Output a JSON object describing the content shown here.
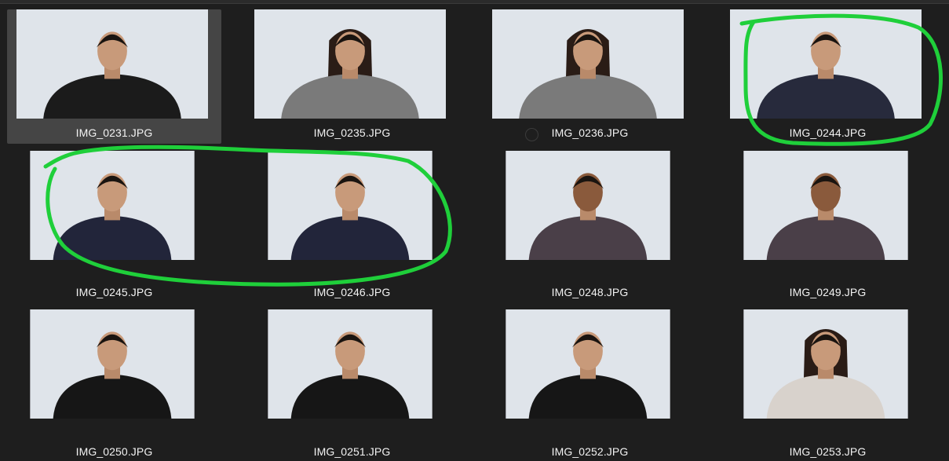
{
  "files": [
    {
      "name": "IMG_0231.JPG",
      "selected": true,
      "person": "man-short-black-tee",
      "shirt": "#1b1b1b"
    },
    {
      "name": "IMG_0235.JPG",
      "selected": false,
      "person": "woman-long-hair-gray",
      "shirt": "#7a7a7a"
    },
    {
      "name": "IMG_0236.JPG",
      "selected": false,
      "person": "woman-long-hair-gray",
      "shirt": "#7a7a7a"
    },
    {
      "name": "IMG_0244.JPG",
      "selected": false,
      "person": "man-wavy-navy",
      "shirt": "#272a3c"
    },
    {
      "name": "IMG_0245.JPG",
      "selected": false,
      "person": "man-wavy-navy",
      "shirt": "#22253a"
    },
    {
      "name": "IMG_0246.JPG",
      "selected": false,
      "person": "man-wavy-navy",
      "shirt": "#22253a"
    },
    {
      "name": "IMG_0248.JPG",
      "selected": false,
      "person": "man-patterned-shirt",
      "shirt": "#4a3f48"
    },
    {
      "name": "IMG_0249.JPG",
      "selected": false,
      "person": "man-patterned-shirt",
      "shirt": "#4a3f48"
    },
    {
      "name": "IMG_0250.JPG",
      "selected": false,
      "person": "man-black-shirt",
      "shirt": "#161616"
    },
    {
      "name": "IMG_0251.JPG",
      "selected": false,
      "person": "man-black-shirt",
      "shirt": "#161616"
    },
    {
      "name": "IMG_0252.JPG",
      "selected": false,
      "person": "man-black-shirt",
      "shirt": "#161616"
    },
    {
      "name": "IMG_0253.JPG",
      "selected": false,
      "person": "woman-floral-blouse",
      "shirt": "#d8d2cc"
    }
  ],
  "colors": {
    "background": "#1e1e1e",
    "selected_tile": "#454545",
    "label_text": "#f2f2f2",
    "annotation_green": "#1fcf3a",
    "photo_backdrop": "#dfe4ea"
  },
  "annotations": [
    {
      "type": "freehand-ellipse",
      "circled_files": [
        "IMG_0244.JPG"
      ]
    },
    {
      "type": "freehand-ellipse",
      "circled_files": [
        "IMG_0245.JPG",
        "IMG_0246.JPG"
      ]
    }
  ]
}
